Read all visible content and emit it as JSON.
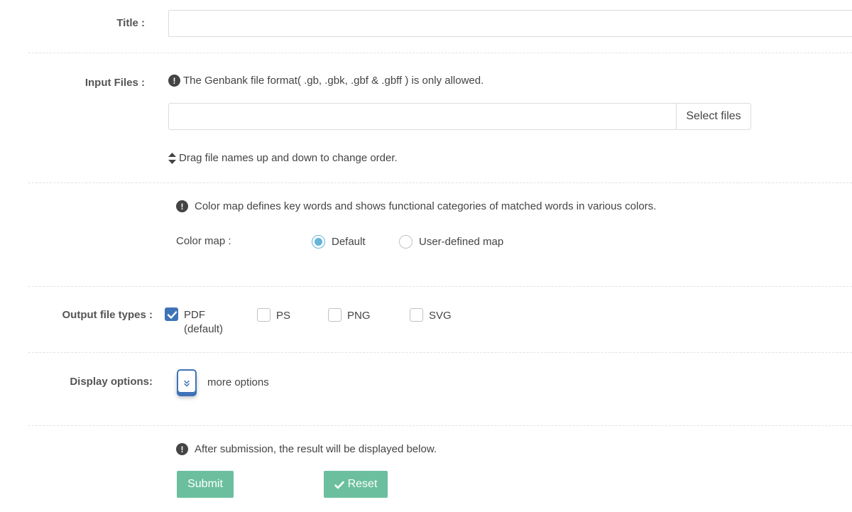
{
  "title_row": {
    "label": "Title :",
    "value": ""
  },
  "input_files": {
    "label": "Input Files :",
    "note": "The Genbank file format( .gb, .gbk, .gbf & .gbff ) is only allowed.",
    "file_value": "",
    "select_label": "Select files",
    "drag_note": "Drag file names up and down to change order."
  },
  "color_map": {
    "note": "Color map defines key words and shows functional categories of matched words in various colors.",
    "label": "Color map :",
    "options": [
      "Default",
      "User-defined map"
    ],
    "selected": "Default"
  },
  "output_types": {
    "label": "Output file types :",
    "options": [
      {
        "label": "PDF",
        "sub": "(default)",
        "checked": true
      },
      {
        "label": "PS",
        "checked": false
      },
      {
        "label": "PNG",
        "checked": false
      },
      {
        "label": "SVG",
        "checked": false
      }
    ]
  },
  "display_options": {
    "label": "Display options:",
    "more_label": "more options"
  },
  "submission": {
    "note": "After submission, the result will be displayed below.",
    "submit_label": "Submit",
    "reset_label": "Reset"
  },
  "colors": {
    "accent_blue": "#3f73b8",
    "radio_blue": "#64b5d9",
    "button_green": "#6bbf9f"
  }
}
